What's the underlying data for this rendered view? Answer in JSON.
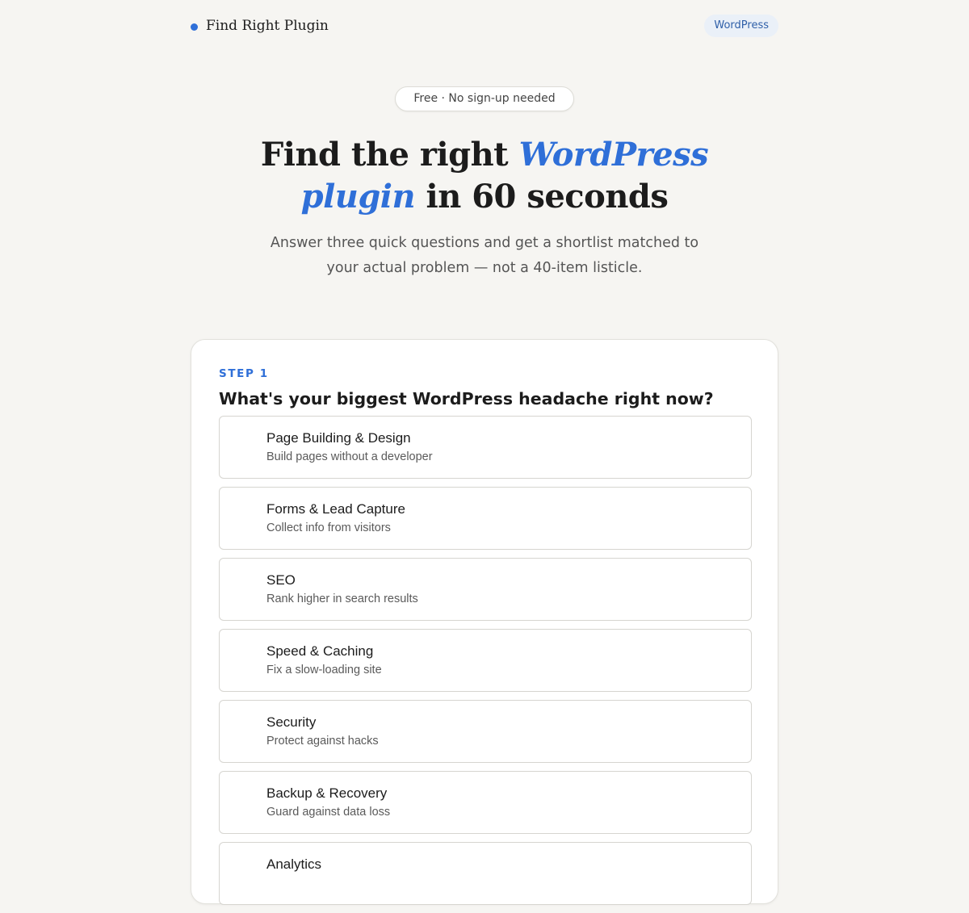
{
  "header": {
    "brand_name": "Find Right Plugin",
    "platform_badge": "WordPress"
  },
  "hero": {
    "pill": "Free · No sign-up needed",
    "title_before": "Find the right ",
    "title_accent": "WordPress plugin",
    "title_after": " in 60 seconds",
    "subtitle": "Answer three quick questions and get a shortlist matched to your actual problem — not a 40-item listicle."
  },
  "step": {
    "label": "STEP 1",
    "question": "What's your biggest WordPress headache right now?",
    "options": [
      {
        "title": "Page Building & Design",
        "desc": "Build pages without a developer"
      },
      {
        "title": "Forms & Lead Capture",
        "desc": "Collect info from visitors"
      },
      {
        "title": "SEO",
        "desc": "Rank higher in search results"
      },
      {
        "title": "Speed & Caching",
        "desc": "Fix a slow-loading site"
      },
      {
        "title": "Security",
        "desc": "Protect against hacks"
      },
      {
        "title": "Backup & Recovery",
        "desc": "Guard against data loss"
      },
      {
        "title": "Analytics",
        "desc": ""
      }
    ]
  },
  "colors": {
    "accent": "#2f6fd8",
    "background": "#f6f5f2",
    "card": "#ffffff"
  }
}
